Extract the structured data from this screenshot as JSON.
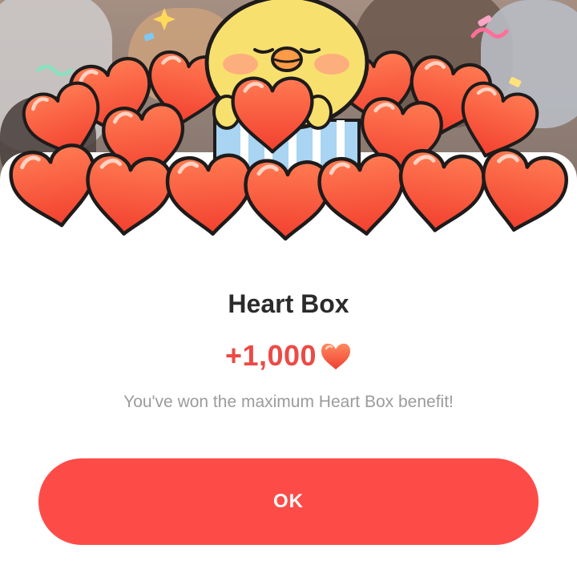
{
  "dialog": {
    "title": "Heart Box",
    "reward_amount": "+1,000",
    "reward_icon": "heart-icon",
    "message": "You've won the maximum Heart Box benefit!",
    "ok_label": "OK"
  },
  "colors": {
    "accent": "#fd4c48",
    "reward_text": "#ec4a45",
    "title_text": "#2b2b2b",
    "message_text": "#9b9b9b",
    "heart_fill": "#f6573d",
    "chick_fill": "#f7df6b"
  }
}
